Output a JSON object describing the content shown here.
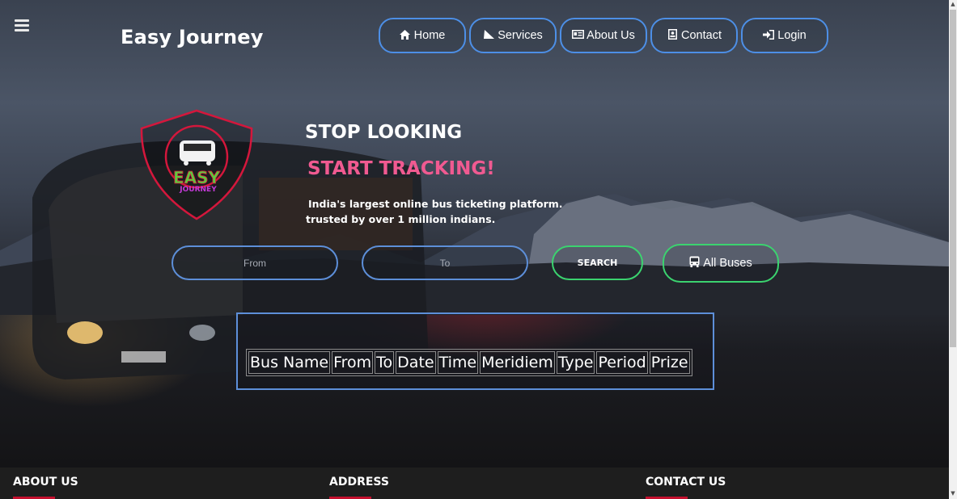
{
  "brand": "Easy Journey",
  "nav": [
    {
      "label": "Home",
      "icon": "home-icon"
    },
    {
      "label": "Services",
      "icon": "services-icon"
    },
    {
      "label": "About Us",
      "icon": "id-card-icon"
    },
    {
      "label": "Contact",
      "icon": "contact-icon"
    },
    {
      "label": "Login",
      "icon": "login-icon"
    }
  ],
  "logo": {
    "line1": "EASY",
    "line2": "JOURNEY"
  },
  "hero": {
    "headline1": "STOP LOOKING",
    "headline2": "START TRACKING!",
    "tagline1": "India's largest online bus ticketing platform.",
    "tagline2": "trusted by over 1 million indians."
  },
  "search": {
    "from_placeholder": "From",
    "to_placeholder": "To",
    "search_label": "SEARCH",
    "all_buses_label": "All Buses"
  },
  "table": {
    "headers": [
      "Bus Name",
      "From",
      "To",
      "Date",
      "Time",
      "Meridiem",
      "Type",
      "Period",
      "Prize"
    ]
  },
  "footer": {
    "about": "ABOUT US",
    "address": "ADDRESS",
    "contact": "CONTACT US"
  },
  "colors": {
    "accent_blue": "#4d8fe6",
    "accent_green": "#3bd36f",
    "accent_pink": "#f05a91",
    "footer_underline": "#c4102e"
  }
}
